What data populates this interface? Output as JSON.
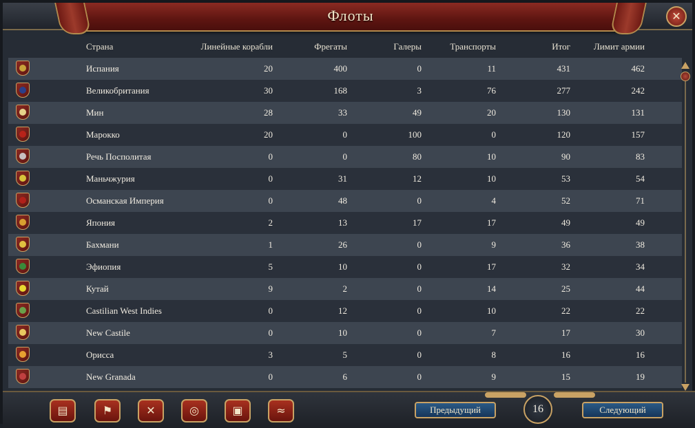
{
  "window": {
    "title": "Флоты"
  },
  "columns": {
    "country": "Страна",
    "ships_of_line": "Линейные корабли",
    "frigates": "Фрегаты",
    "galleys": "Галеры",
    "transports": "Транспорты",
    "total": "Итог",
    "army_limit": "Лимит армии"
  },
  "rows": [
    {
      "country": "Испания",
      "ships_of_line": "20",
      "frigates": "400",
      "galleys": "0",
      "transports": "11",
      "total": "431",
      "army_limit": "462",
      "flag_color": "#c8a23a"
    },
    {
      "country": "Великобритания",
      "ships_of_line": "30",
      "frigates": "168",
      "galleys": "3",
      "transports": "76",
      "total": "277",
      "army_limit": "242",
      "flag_color": "#2b3f8a"
    },
    {
      "country": "Мин",
      "ships_of_line": "28",
      "frigates": "33",
      "galleys": "49",
      "transports": "20",
      "total": "130",
      "army_limit": "131",
      "flag_color": "#e6d28a"
    },
    {
      "country": "Марокко",
      "ships_of_line": "20",
      "frigates": "0",
      "galleys": "100",
      "transports": "0",
      "total": "120",
      "army_limit": "157",
      "flag_color": "#b8231a"
    },
    {
      "country": "Речь Посполитая",
      "ships_of_line": "0",
      "frigates": "0",
      "galleys": "80",
      "transports": "10",
      "total": "90",
      "army_limit": "83",
      "flag_color": "#c8c0c0"
    },
    {
      "country": "Маньчжурия",
      "ships_of_line": "0",
      "frigates": "31",
      "galleys": "12",
      "transports": "10",
      "total": "53",
      "army_limit": "54",
      "flag_color": "#d8c23a"
    },
    {
      "country": "Османская Империя",
      "ships_of_line": "0",
      "frigates": "48",
      "galleys": "0",
      "transports": "4",
      "total": "52",
      "army_limit": "71",
      "flag_color": "#b0201a"
    },
    {
      "country": "Япония",
      "ships_of_line": "2",
      "frigates": "13",
      "galleys": "17",
      "transports": "17",
      "total": "49",
      "army_limit": "49",
      "flag_color": "#d8a030"
    },
    {
      "country": "Бахмани",
      "ships_of_line": "1",
      "frigates": "26",
      "galleys": "0",
      "transports": "9",
      "total": "36",
      "army_limit": "38",
      "flag_color": "#e0c040"
    },
    {
      "country": "Эфиопия",
      "ships_of_line": "5",
      "frigates": "10",
      "galleys": "0",
      "transports": "17",
      "total": "32",
      "army_limit": "34",
      "flag_color": "#3a8a3a"
    },
    {
      "country": "Кутай",
      "ships_of_line": "9",
      "frigates": "2",
      "galleys": "0",
      "transports": "14",
      "total": "25",
      "army_limit": "44",
      "flag_color": "#e8d830"
    },
    {
      "country": "Castilian West Indies",
      "ships_of_line": "0",
      "frigates": "12",
      "galleys": "0",
      "transports": "10",
      "total": "22",
      "army_limit": "22",
      "flag_color": "#6aa04a"
    },
    {
      "country": "New Castile",
      "ships_of_line": "0",
      "frigates": "10",
      "galleys": "0",
      "transports": "7",
      "total": "17",
      "army_limit": "30",
      "flag_color": "#e8c860"
    },
    {
      "country": "Орисса",
      "ships_of_line": "3",
      "frigates": "5",
      "galleys": "0",
      "transports": "8",
      "total": "16",
      "army_limit": "16",
      "flag_color": "#e8a030"
    },
    {
      "country": "New Granada",
      "ships_of_line": "0",
      "frigates": "6",
      "galleys": "0",
      "transports": "9",
      "total": "15",
      "army_limit": "19",
      "flag_color": "#c04040"
    }
  ],
  "toolbar": {
    "icons": [
      "ledger-icon",
      "flag-icon",
      "crossed-swords-icon",
      "coins-icon",
      "trade-goods-icon",
      "handshake-icon"
    ],
    "prev_label": "Предыдущий",
    "next_label": "Следующий",
    "page_number": "16"
  },
  "colors": {
    "accent_gold": "#c9a264",
    "title_red": "#5e1511",
    "nav_blue": "#1f466e"
  }
}
